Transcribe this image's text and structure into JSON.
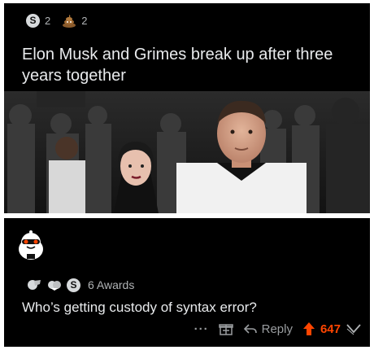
{
  "post": {
    "awards": [
      {
        "icon": "silver-coin-icon",
        "glyph": "S",
        "count": "2"
      },
      {
        "icon": "poop-award-icon",
        "count": "2"
      }
    ],
    "title": "Elon Musk and Grimes break up after three years together"
  },
  "comment": {
    "awards_label": "6 Awards",
    "award_coin_glyph": "S",
    "body": "Who’s getting custody of syntax error?",
    "actions": {
      "more_label": "···",
      "reply_label": "Reply",
      "score": "647"
    }
  },
  "colors": {
    "background": "#000000",
    "text": "#e8eaec",
    "muted": "#9a9da0",
    "upvote": "#ff4500"
  }
}
